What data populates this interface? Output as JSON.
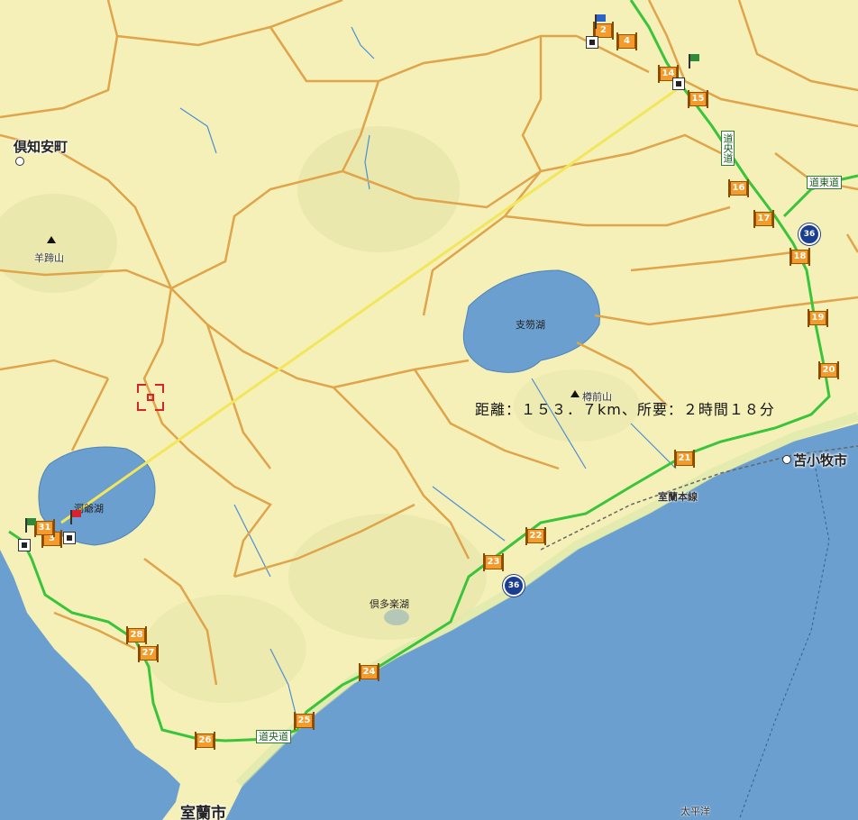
{
  "map": {
    "colors": {
      "land": "#f4f0b8",
      "sea": "#6b9fcf",
      "lake": "#6b9fcf",
      "roads": "#e0a44a",
      "expressway": "#39c43a",
      "route_line": "#f2e65c",
      "river": "#4b8ed6"
    },
    "cities": [
      {
        "id": "kutchan",
        "name": "倶知安町"
      },
      {
        "id": "tomakomai",
        "name": "苫小牧市"
      },
      {
        "id": "muroran",
        "name": "室蘭市"
      }
    ],
    "mountains": [
      {
        "id": "yoteizan",
        "name": "羊蹄山"
      },
      {
        "id": "tarumaesan",
        "name": "樽前山"
      }
    ],
    "lakes": [
      {
        "id": "shikotsuko",
        "name": "支笏湖"
      },
      {
        "id": "toyako",
        "name": "洞爺湖"
      },
      {
        "id": "kuttarako",
        "name": "倶多楽湖"
      }
    ],
    "road_labels": {
      "doo_vertical": "道央道",
      "doto": "道東道",
      "doo_south": "道央道",
      "muroran_line": "室蘭本線"
    },
    "sea_label": "太平洋",
    "route_shields": [
      "36",
      "36"
    ],
    "junction_markers": [
      "2",
      "4",
      "14",
      "15",
      "16",
      "17",
      "18",
      "19",
      "20",
      "21",
      "22",
      "23",
      "24",
      "25",
      "26",
      "27",
      "28",
      "3",
      "31"
    ],
    "measurement": {
      "text": "距離：１５３．７km、所要：２時間１８分"
    },
    "icons": [
      "start-flag-icon",
      "end-flag-icon",
      "goal-flag-icon",
      "crosshair-icon",
      "peak-icon",
      "poi-icon"
    ]
  }
}
